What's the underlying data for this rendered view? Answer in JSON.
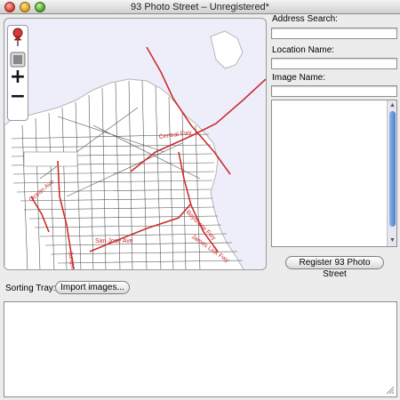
{
  "window": {
    "title": "93 Photo Street – Unregistered*"
  },
  "map": {
    "tools": [
      "pushpin-icon",
      "stop-square-icon",
      "zoom-in-icon",
      "zoom-out-icon"
    ],
    "zoom_in_glyph": "+",
    "zoom_out_glyph": "−",
    "street_labels": [
      "Central Fwy",
      "San Jose Ave",
      "James Lick Fwy",
      "Bayshore Fwy",
      "Junipero Serra",
      "Ocean Ave"
    ],
    "colors": {
      "water": "#eeeefb",
      "land": "#ffffff",
      "streets": "#555555",
      "highways": "#cc2e2e"
    }
  },
  "sidebar": {
    "address_label": "Address Search:",
    "address_value": "",
    "location_label": "Location Name:",
    "location_value": "",
    "image_label": "Image Name:",
    "image_value": "",
    "notes_value": "",
    "register_button": "Register 93 Photo Street"
  },
  "sorting_tray": {
    "label": "Sorting Tray:",
    "import_button": "Import images..."
  }
}
